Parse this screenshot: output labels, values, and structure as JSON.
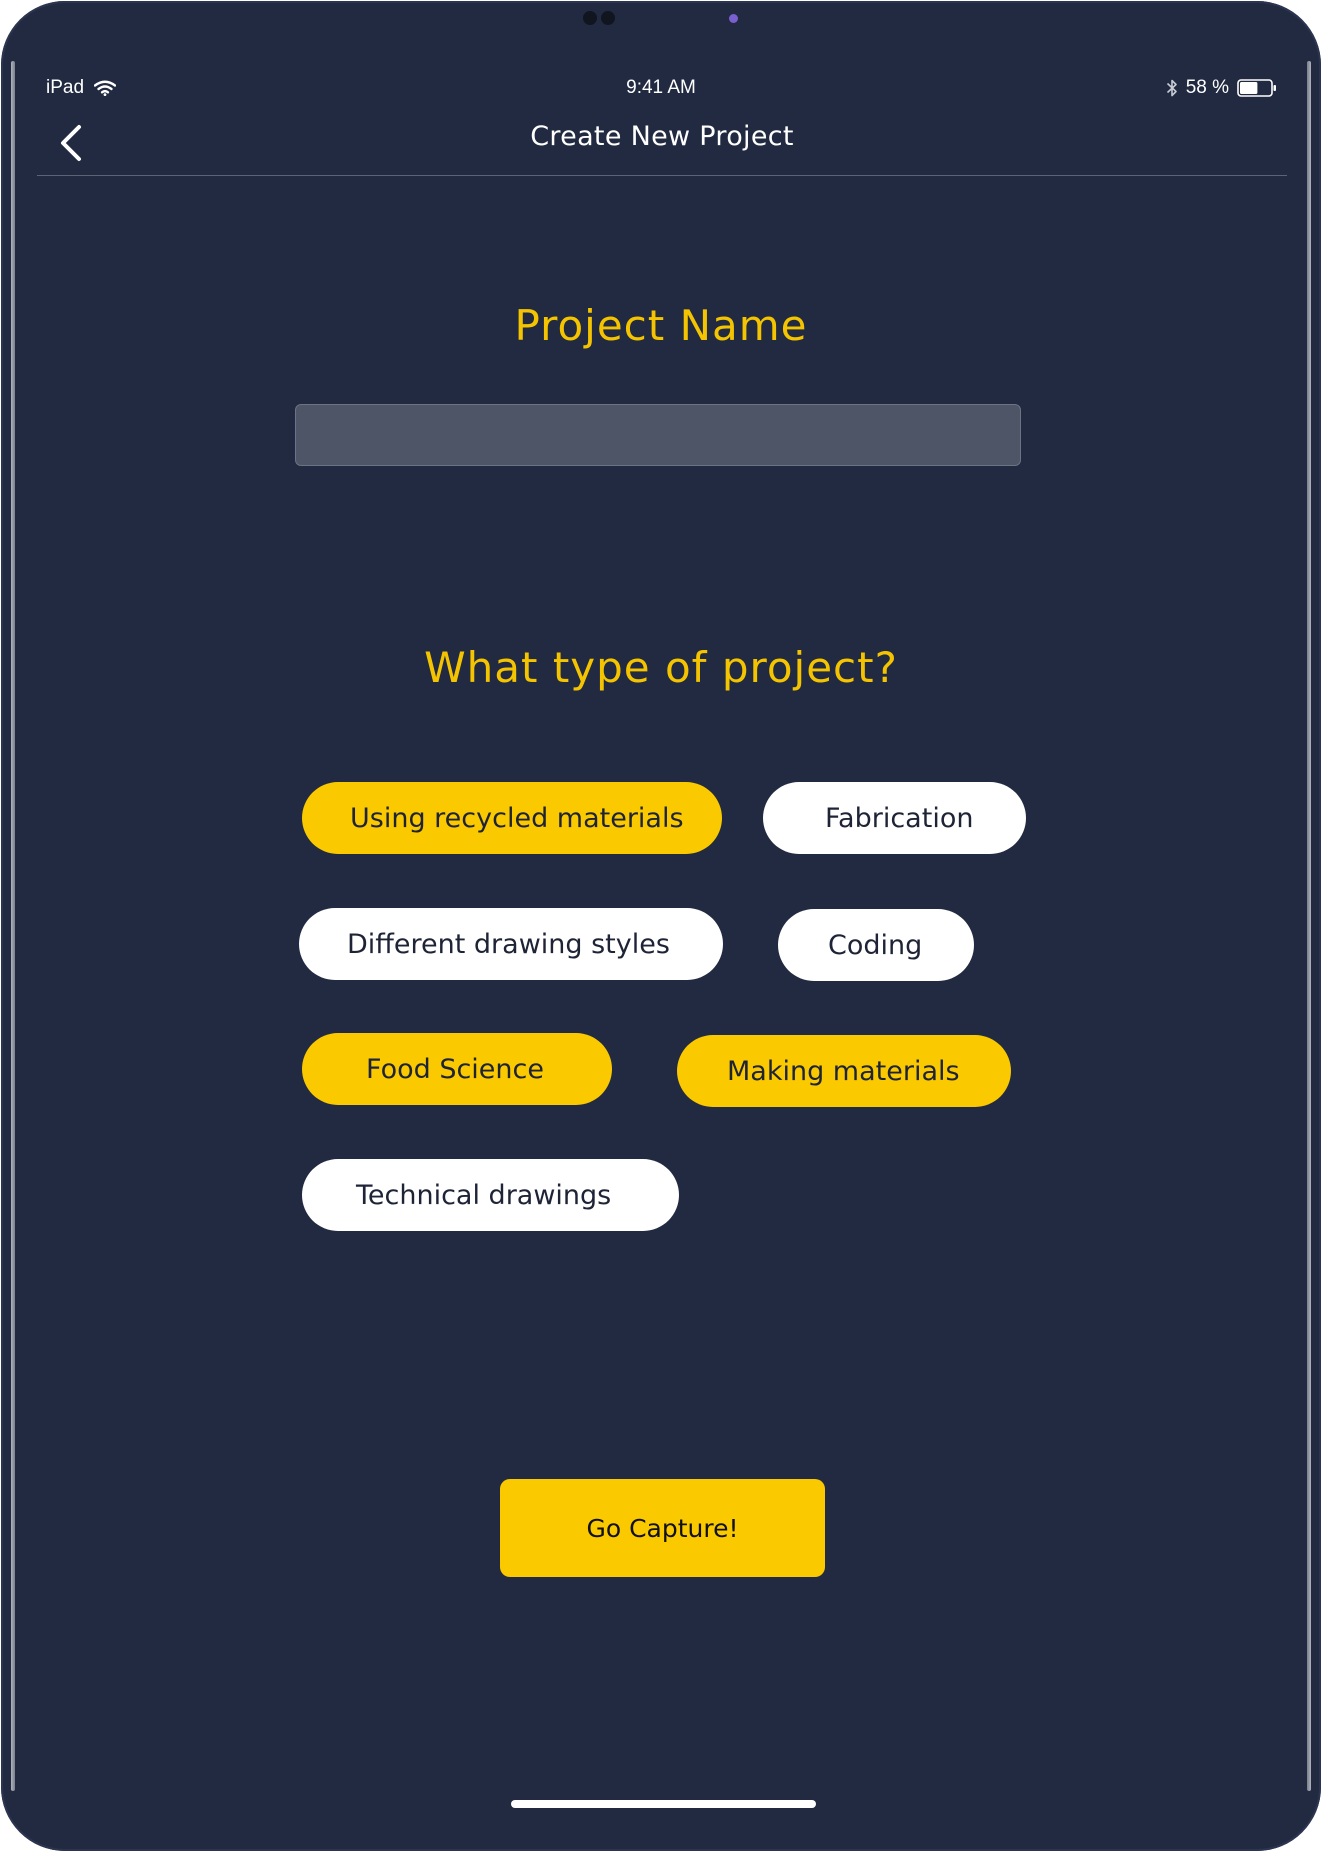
{
  "status_bar": {
    "device": "iPad",
    "time": "9:41 AM",
    "battery": "58 %",
    "battery_level": 0.58
  },
  "nav": {
    "title": "Create New Project",
    "back_icon": "chevron-left-icon"
  },
  "project_name": {
    "label": "Project Name",
    "value": "",
    "placeholder": ""
  },
  "project_type": {
    "label": "What type of project?",
    "chips": [
      {
        "label": "Using recycled materials",
        "selected": true
      },
      {
        "label": "Fabrication",
        "selected": false
      },
      {
        "label": "Different drawing styles",
        "selected": false
      },
      {
        "label": "Coding",
        "selected": false
      },
      {
        "label": "Food Science",
        "selected": true
      },
      {
        "label": "Making materials",
        "selected": true
      },
      {
        "label": "Technical drawings",
        "selected": false
      }
    ]
  },
  "action": {
    "go_label": "Go Capture!"
  },
  "colors": {
    "background": "#212a41",
    "accent": "#fbc900",
    "chip_unselected": "#ffffff",
    "input_bg": "#4d5566"
  }
}
